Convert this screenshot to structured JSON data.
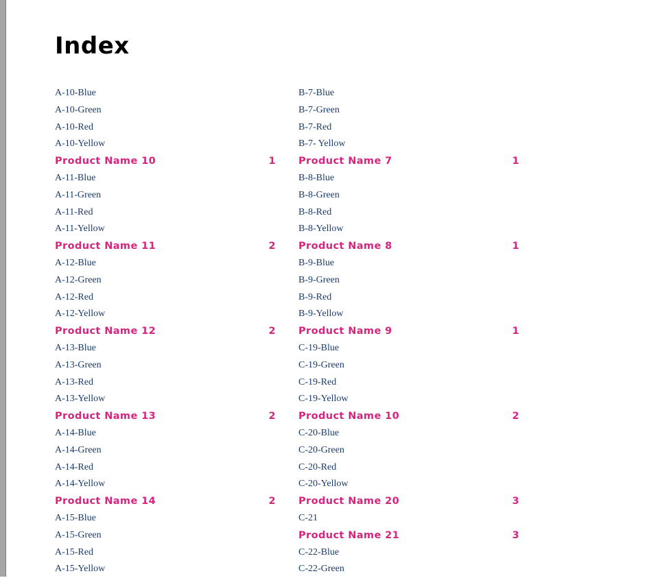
{
  "title": "Index",
  "columns": [
    {
      "rows": [
        {
          "kind": "item",
          "text": "A-10-Blue"
        },
        {
          "kind": "item",
          "text": "A-10-Green"
        },
        {
          "kind": "item",
          "text": "A-10-Red"
        },
        {
          "kind": "item",
          "text": "A-10-Yellow"
        },
        {
          "kind": "heading",
          "text": "Product Name 10",
          "page": "1"
        },
        {
          "kind": "item",
          "text": "A-11-Blue"
        },
        {
          "kind": "item",
          "text": "A-11-Green"
        },
        {
          "kind": "item",
          "text": "A-11-Red"
        },
        {
          "kind": "item",
          "text": "A-11-Yellow"
        },
        {
          "kind": "heading",
          "text": "Product Name 11",
          "page": "2"
        },
        {
          "kind": "item",
          "text": "A-12-Blue"
        },
        {
          "kind": "item",
          "text": "A-12-Green"
        },
        {
          "kind": "item",
          "text": "A-12-Red"
        },
        {
          "kind": "item",
          "text": "A-12-Yellow"
        },
        {
          "kind": "heading",
          "text": "Product Name 12",
          "page": "2"
        },
        {
          "kind": "item",
          "text": "A-13-Blue"
        },
        {
          "kind": "item",
          "text": "A-13-Green"
        },
        {
          "kind": "item",
          "text": "A-13-Red"
        },
        {
          "kind": "item",
          "text": "A-13-Yellow"
        },
        {
          "kind": "heading",
          "text": "Product Name 13",
          "page": "2"
        },
        {
          "kind": "item",
          "text": "A-14-Blue"
        },
        {
          "kind": "item",
          "text": "A-14-Green"
        },
        {
          "kind": "item",
          "text": "A-14-Red"
        },
        {
          "kind": "item",
          "text": "A-14-Yellow"
        },
        {
          "kind": "heading",
          "text": "Product Name 14",
          "page": "2"
        },
        {
          "kind": "item",
          "text": "A-15-Blue"
        },
        {
          "kind": "item",
          "text": "A-15-Green"
        },
        {
          "kind": "item",
          "text": "A-15-Red"
        },
        {
          "kind": "item",
          "text": "A-15-Yellow"
        }
      ]
    },
    {
      "rows": [
        {
          "kind": "item",
          "text": "B-7-Blue"
        },
        {
          "kind": "item",
          "text": "B-7-Green"
        },
        {
          "kind": "item",
          "text": "B-7-Red"
        },
        {
          "kind": "item",
          "text": "B-7- Yellow"
        },
        {
          "kind": "heading",
          "text": "Product Name 7",
          "page": "1"
        },
        {
          "kind": "item",
          "text": "B-8-Blue"
        },
        {
          "kind": "item",
          "text": "B-8-Green"
        },
        {
          "kind": "item",
          "text": "B-8-Red"
        },
        {
          "kind": "item",
          "text": "B-8-Yellow"
        },
        {
          "kind": "heading",
          "text": "Product Name 8",
          "page": "1"
        },
        {
          "kind": "item",
          "text": "B-9-Blue"
        },
        {
          "kind": "item",
          "text": "B-9-Green"
        },
        {
          "kind": "item",
          "text": "B-9-Red"
        },
        {
          "kind": "item",
          "text": "B-9-Yellow"
        },
        {
          "kind": "heading",
          "text": "Product Name 9",
          "page": "1"
        },
        {
          "kind": "item",
          "text": "C-19-Blue"
        },
        {
          "kind": "item",
          "text": "C-19-Green"
        },
        {
          "kind": "item",
          "text": "C-19-Red"
        },
        {
          "kind": "item",
          "text": "C-19-Yellow"
        },
        {
          "kind": "heading",
          "text": "Product Name 10",
          "page": "2"
        },
        {
          "kind": "item",
          "text": "C-20-Blue"
        },
        {
          "kind": "item",
          "text": "C-20-Green"
        },
        {
          "kind": "item",
          "text": "C-20-Red"
        },
        {
          "kind": "item",
          "text": "C-20-Yellow"
        },
        {
          "kind": "heading",
          "text": "Product Name 20",
          "page": "3"
        },
        {
          "kind": "item",
          "text": "C-21"
        },
        {
          "kind": "heading",
          "text": "Product Name 21",
          "page": "3"
        },
        {
          "kind": "item",
          "text": "C-22-Blue"
        },
        {
          "kind": "item",
          "text": "C-22-Green"
        }
      ]
    }
  ],
  "colors": {
    "item_text": "#1a3a6b",
    "heading_text": "#d4267f",
    "gutter": "#a6a6a6"
  }
}
